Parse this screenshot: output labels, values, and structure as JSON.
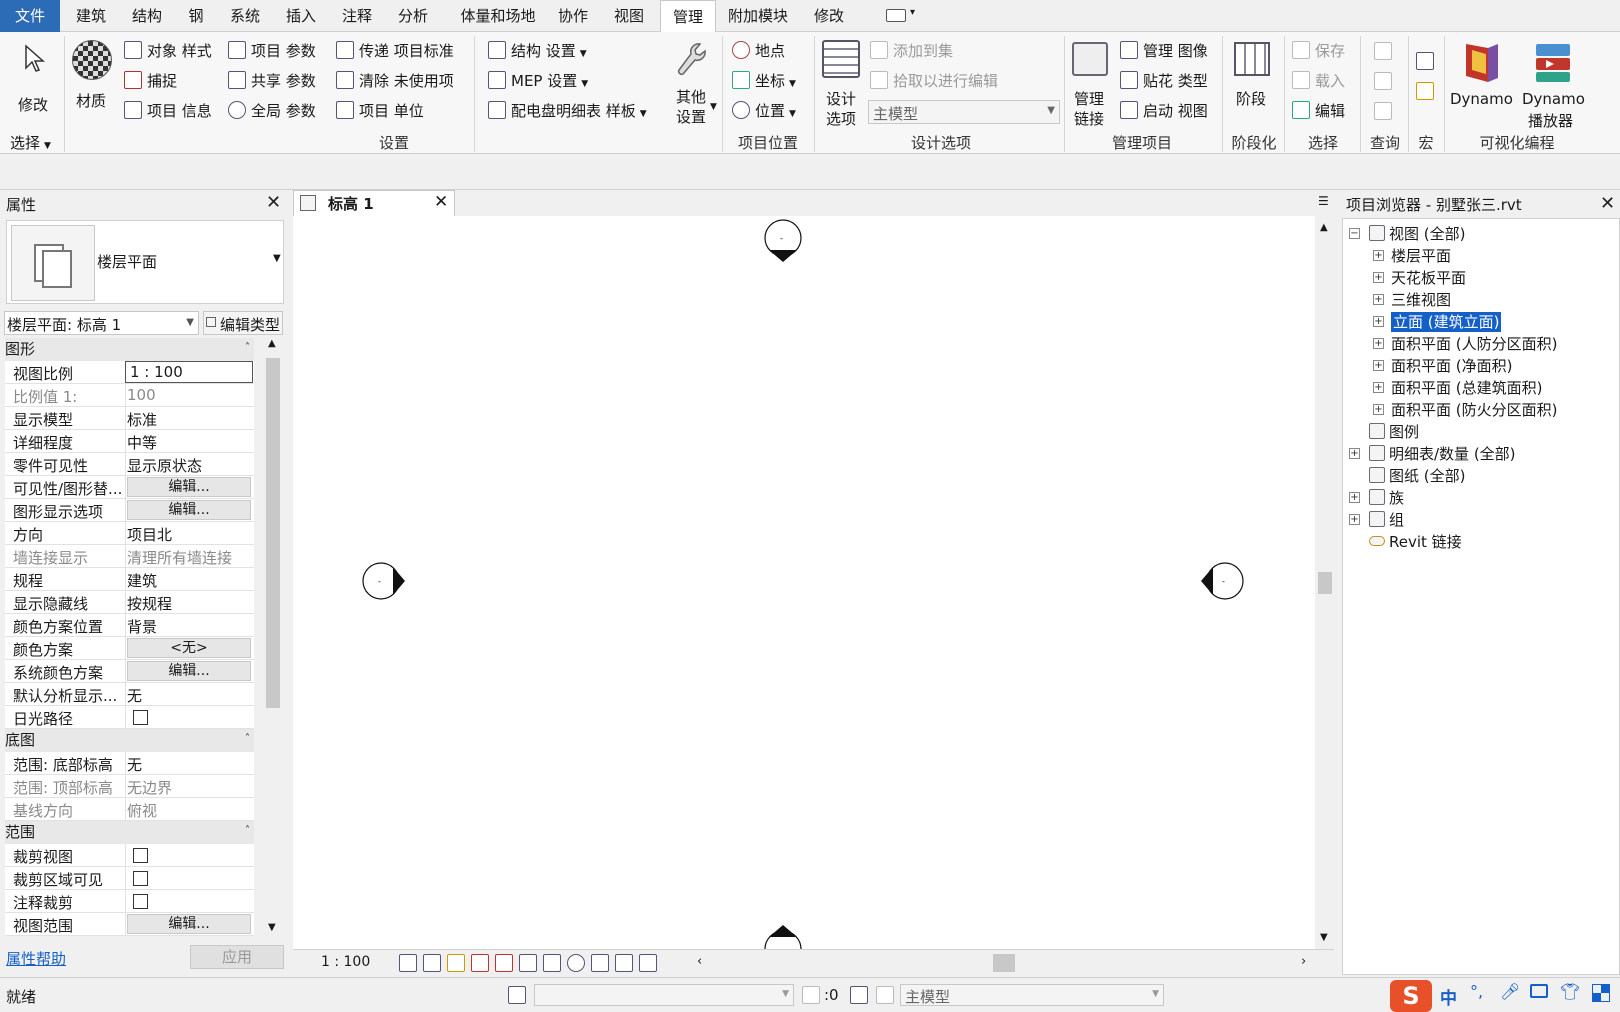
{
  "menu": {
    "tabs": [
      "文件",
      "建筑",
      "结构",
      "钢",
      "系统",
      "插入",
      "注释",
      "分析",
      "体量和场地",
      "协作",
      "视图",
      "管理",
      "附加模块",
      "修改"
    ],
    "active_tab": "管理"
  },
  "ribbon": {
    "select": {
      "modify": "修改",
      "group": "选择"
    },
    "settings": {
      "material": "材质",
      "object_styles": "对象 样式",
      "snaps": "捕捉",
      "project_info": "项目 信息",
      "project_params": "项目 参数",
      "shared_params": "共享 参数",
      "global_params": "全局  参数",
      "transfer_standards": "传递 项目标准",
      "purge_unused": "清除 未使用项",
      "project_units": "项目 单位",
      "structural_settings": "结构 设置",
      "mep_settings": "MEP 设置",
      "panel_schedule_templates": "配电盘明细表 样板",
      "additional_settings_1": "其他",
      "additional_settings_2": "设置",
      "group": "设置"
    },
    "project_location": {
      "location": "地点",
      "coordinates": "坐标",
      "position": "位置",
      "group": "项目位置"
    },
    "design_options": {
      "design_options_1": "设计",
      "design_options_2": "选项",
      "add_to_set": "添加到集",
      "pick_to_edit": "拾取以进行编辑",
      "main_model": "主模型",
      "group": "设计选项"
    },
    "manage_project": {
      "manage_links_1": "管理",
      "manage_links_2": "链接",
      "manage_images": "管理 图像",
      "decal_types": "贴花 类型",
      "starting_view": "启动 视图",
      "group": "管理项目"
    },
    "phasing": {
      "phases": "阶段",
      "group": "阶段化"
    },
    "selection": {
      "save": "保存",
      "load": "载入",
      "edit": "编辑",
      "group": "选择"
    },
    "inquiry": {
      "group": "查询"
    },
    "macros": {
      "group": "宏"
    },
    "visual_programming": {
      "dynamo": "Dynamo",
      "dynamo_player_1": "Dynamo",
      "dynamo_player_2": "播放器",
      "group": "可视化编程"
    }
  },
  "properties": {
    "title": "属性",
    "type_name": "楼层平面",
    "instance_selector": "楼层平面: 标高 1",
    "edit_type": "编辑类型",
    "sections": [
      {
        "name": "图形",
        "rows": [
          {
            "k": "视图比例",
            "v": "1 : 100",
            "kind": "input"
          },
          {
            "k": "比例值 1:",
            "v": "100",
            "kind": "grey"
          },
          {
            "k": "显示模型",
            "v": "标准",
            "kind": "text"
          },
          {
            "k": "详细程度",
            "v": "中等",
            "kind": "text"
          },
          {
            "k": "零件可见性",
            "v": "显示原状态",
            "kind": "text"
          },
          {
            "k": "可见性/图形替...",
            "v": "编辑...",
            "kind": "button"
          },
          {
            "k": "图形显示选项",
            "v": "编辑...",
            "kind": "button"
          },
          {
            "k": "方向",
            "v": "项目北",
            "kind": "text"
          },
          {
            "k": "墙连接显示",
            "v": "清理所有墙连接",
            "kind": "grey"
          },
          {
            "k": "规程",
            "v": "建筑",
            "kind": "text"
          },
          {
            "k": "显示隐藏线",
            "v": "按规程",
            "kind": "text"
          },
          {
            "k": "颜色方案位置",
            "v": "背景",
            "kind": "text"
          },
          {
            "k": "颜色方案",
            "v": "<无>",
            "kind": "button"
          },
          {
            "k": "系统颜色方案",
            "v": "编辑...",
            "kind": "button"
          },
          {
            "k": "默认分析显示...",
            "v": "无",
            "kind": "text"
          },
          {
            "k": "日光路径",
            "v": "",
            "kind": "check"
          }
        ]
      },
      {
        "name": "底图",
        "rows": [
          {
            "k": "范围: 底部标高",
            "v": "无",
            "kind": "text"
          },
          {
            "k": "范围: 顶部标高",
            "v": "无边界",
            "kind": "grey"
          },
          {
            "k": "基线方向",
            "v": "俯视",
            "kind": "grey"
          }
        ]
      },
      {
        "name": "范围",
        "rows": [
          {
            "k": "裁剪视图",
            "v": "",
            "kind": "check"
          },
          {
            "k": "裁剪区域可见",
            "v": "",
            "kind": "check"
          },
          {
            "k": "注释裁剪",
            "v": "",
            "kind": "check"
          },
          {
            "k": "视图范围",
            "v": "编辑...",
            "kind": "button"
          }
        ]
      }
    ],
    "help_link": "属性帮助",
    "apply": "应用"
  },
  "view_tab": {
    "title": "标高 1",
    "scale": "1 : 100"
  },
  "browser": {
    "title": "项目浏览器 - 别墅张三.rvt",
    "nodes": [
      {
        "label": "视图 (全部)",
        "level": 0,
        "pm": "-"
      },
      {
        "label": "楼层平面",
        "level": 1,
        "pm": "+"
      },
      {
        "label": "天花板平面",
        "level": 1,
        "pm": "+"
      },
      {
        "label": "三维视图",
        "level": 1,
        "pm": "+"
      },
      {
        "label": "立面 (建筑立面)",
        "level": 1,
        "pm": "+",
        "selected": true
      },
      {
        "label": "面积平面 (人防分区面积)",
        "level": 1,
        "pm": "+"
      },
      {
        "label": "面积平面 (净面积)",
        "level": 1,
        "pm": "+"
      },
      {
        "label": "面积平面 (总建筑面积)",
        "level": 1,
        "pm": "+"
      },
      {
        "label": "面积平面 (防火分区面积)",
        "level": 1,
        "pm": "+"
      },
      {
        "label": "图例",
        "level": 0,
        "pm": ""
      },
      {
        "label": "明细表/数量 (全部)",
        "level": 0,
        "pm": "+"
      },
      {
        "label": "图纸 (全部)",
        "level": 0,
        "pm": ""
      },
      {
        "label": "族",
        "level": 0,
        "pm": "+"
      },
      {
        "label": "组",
        "level": 0,
        "pm": "+"
      },
      {
        "label": "Revit 链接",
        "level": 0,
        "pm": ""
      }
    ]
  },
  "status": {
    "ready": "就绪",
    "selection_count": ":0",
    "model": "主模型",
    "ime_lang": "中"
  },
  "colors": {
    "accent": "#2c6bb5",
    "selection": "#1560c8",
    "brand_sogou": "#e8502a"
  }
}
